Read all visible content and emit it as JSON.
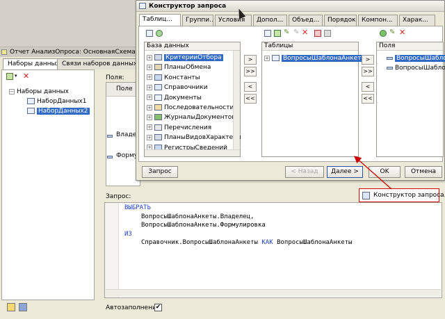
{
  "background_window": {
    "title": "Отчет АнализОпроса: ОсновнаяСхема",
    "tabs": [
      "Наборы данных",
      "Связи наборов данных"
    ],
    "tree": {
      "root": "Наборы данных",
      "items": [
        "НаборДанных1",
        "НаборДанных2"
      ],
      "selected_index": 1
    },
    "fields_label": "Поля:",
    "fields_header": "Поле",
    "field_rows": [
      "Владелец",
      "Формулировка"
    ],
    "query_label": "Запрос:",
    "query_builder_button": "Конструктор запроса...",
    "query_lines": [
      {
        "text": "ВЫБРАТЬ",
        "keyword": true,
        "indent": 0
      },
      {
        "text": "ВопросыШаблонаАнкеты.Владелец,",
        "keyword": false,
        "indent": 1
      },
      {
        "text": "ВопросыШаблонаАнкеты.Формулировка",
        "keyword": false,
        "indent": 1
      },
      {
        "text": "ИЗ",
        "keyword": true,
        "indent": 0
      },
      {
        "parts": [
          {
            "text": "Справочник.ВопросыШаблонаАнкеты ",
            "keyword": false
          },
          {
            "text": "КАК",
            "keyword": true
          },
          {
            "text": " ВопросыШаблонаАнкеты",
            "keyword": false
          }
        ],
        "indent": 1
      }
    ],
    "autofill_label": "Автозаполнение",
    "autofill_checked": true,
    "autofill_mark": "✔"
  },
  "dialog": {
    "title": "Конструктор запроса",
    "tabs": [
      "Таблиц...",
      "Группи...",
      "Условия",
      "Допол...",
      "Объед...",
      "Порядок",
      "Компон...",
      "Харак..."
    ],
    "active_tab_index": 0,
    "database_panel": {
      "header": "База данных",
      "items": [
        "КритерииОтбора",
        "ПланыОбмена",
        "Константы",
        "Справочники",
        "Документы",
        "Последовательности",
        "ЖурналыДокументов",
        "Перечисления",
        "ПланыВидовХарактери",
        "РегистрыСведений"
      ],
      "selected_index": 0
    },
    "tables_panel": {
      "header": "Таблицы",
      "items": [
        "ВопросыШаблонаАнкеты"
      ],
      "selected_index": 0
    },
    "fields_panel": {
      "header": "Поля",
      "items": [
        "ВопросыШаблон",
        "ВопросыШаблон"
      ],
      "selected_index": 0
    },
    "move_buttons": [
      ">",
      ">>",
      "<",
      "<<"
    ],
    "buttons": {
      "query": "Запрос",
      "back": "< Назад",
      "next": "Далее >",
      "ok": "OK",
      "cancel": "Отмена"
    }
  },
  "colors": {
    "selection": "#316ac5",
    "keyword": "#1f3fbf",
    "highlight_border": "#cc0000",
    "annotation_arrow": "#cc0000"
  }
}
